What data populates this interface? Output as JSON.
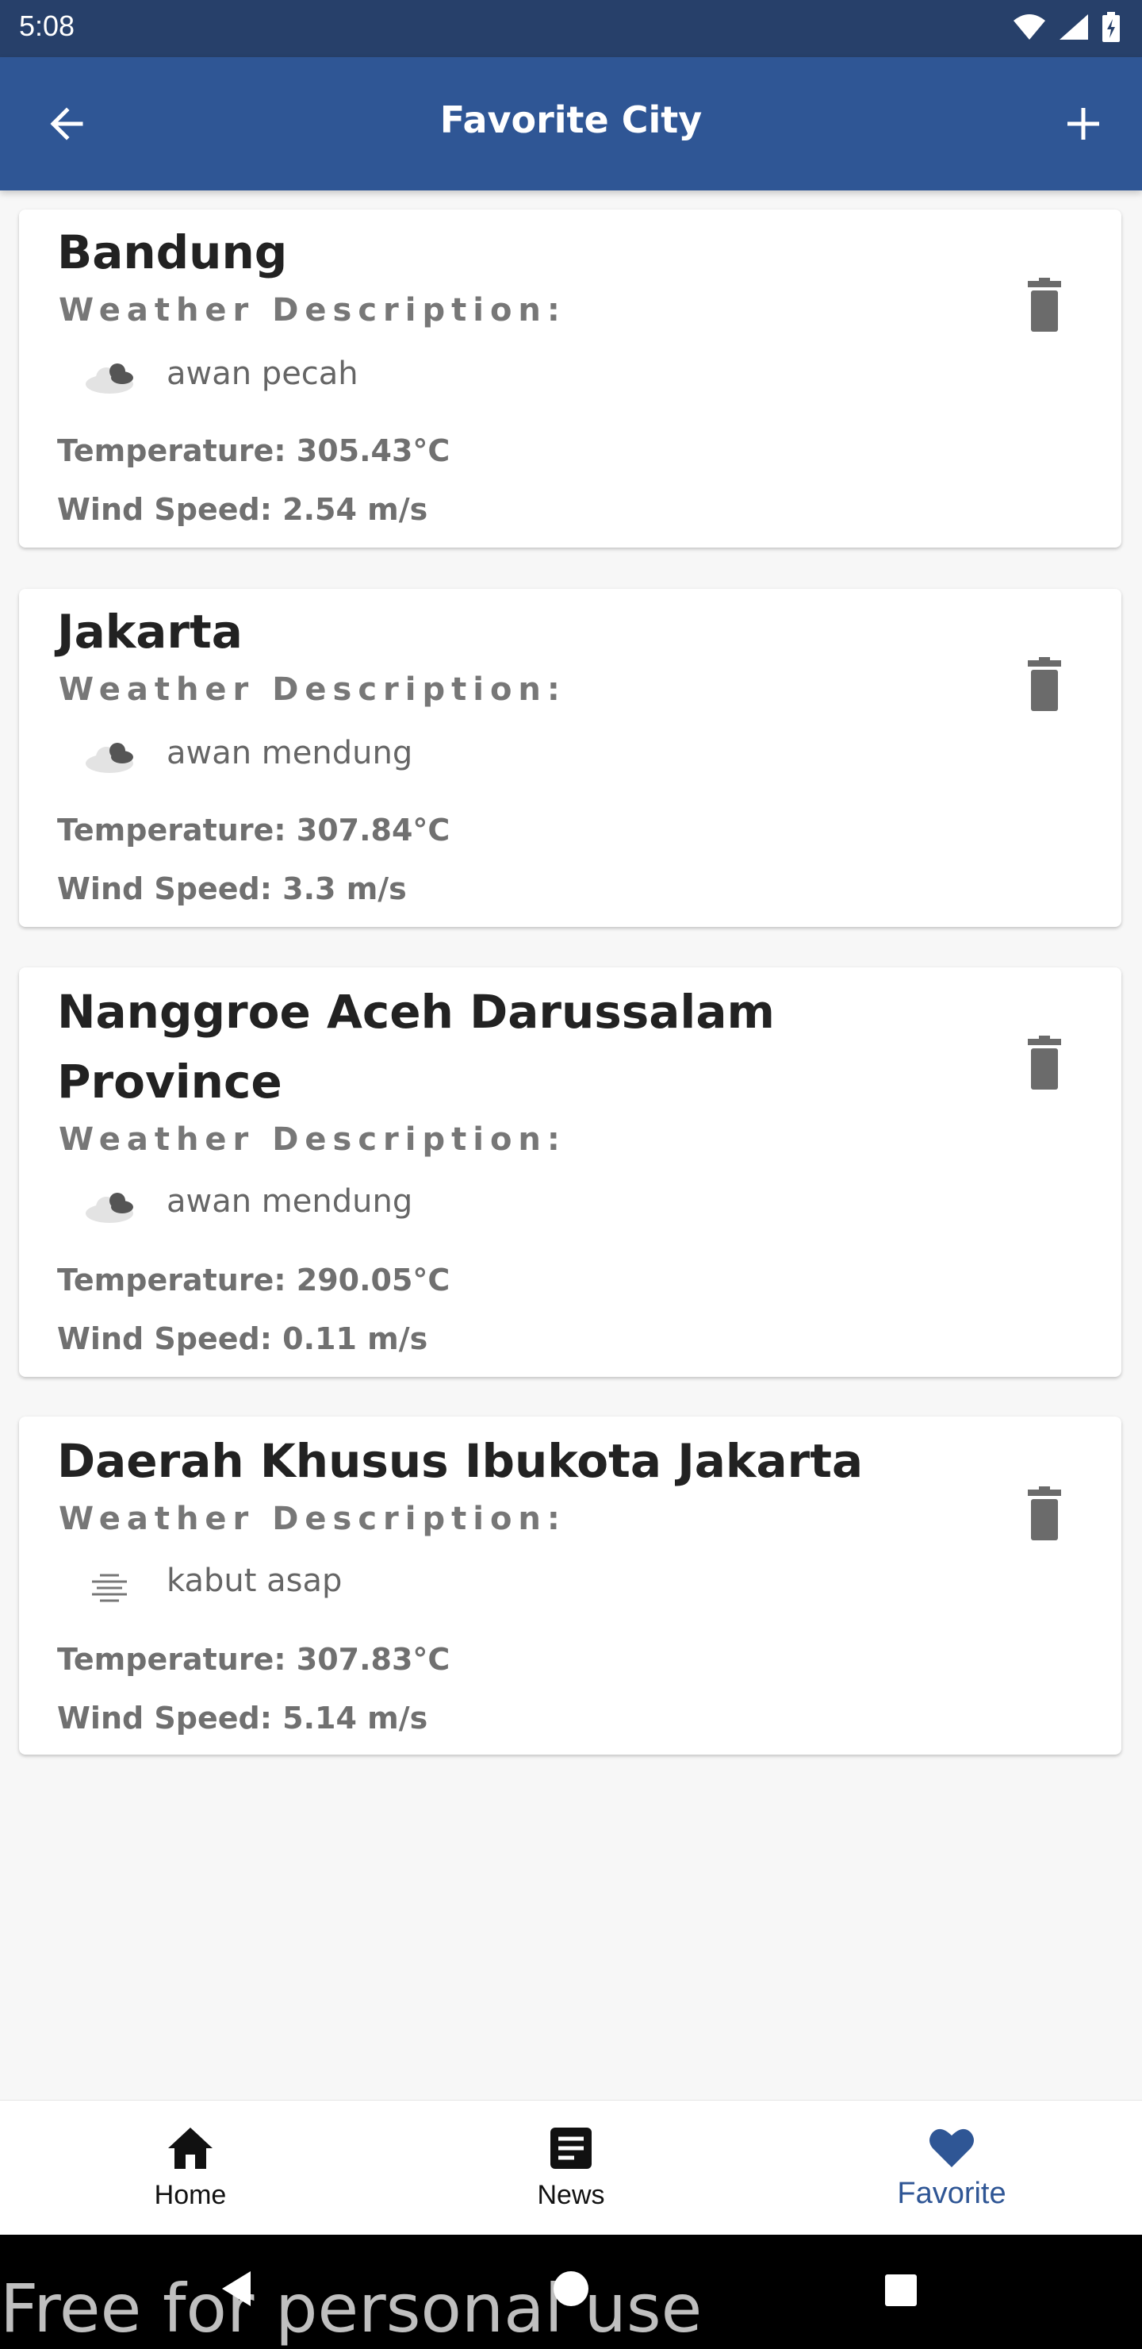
{
  "status_bar": {
    "time": "5:08"
  },
  "app_bar": {
    "title": "Favorite City"
  },
  "labels": {
    "weather_description": "Weather Description:"
  },
  "cities": [
    {
      "name": "Bandung",
      "description": "awan pecah",
      "icon": "broken-clouds-icon",
      "temperature": "Temperature: 305.43°C",
      "wind_speed": "Wind Speed: 2.54 m/s"
    },
    {
      "name": "Jakarta",
      "description": "awan mendung",
      "icon": "overcast-clouds-icon",
      "temperature": "Temperature: 307.84°C",
      "wind_speed": "Wind Speed: 3.3 m/s"
    },
    {
      "name": "Nanggroe Aceh Darussalam Province",
      "description": "awan mendung",
      "icon": "overcast-clouds-icon",
      "temperature": "Temperature: 290.05°C",
      "wind_speed": "Wind Speed: 0.11 m/s"
    },
    {
      "name": "Daerah Khusus Ibukota Jakarta",
      "description": "kabut asap",
      "icon": "haze-icon",
      "temperature": "Temperature: 307.83°C",
      "wind_speed": "Wind Speed: 5.14 m/s"
    }
  ],
  "bottom_nav": {
    "items": [
      {
        "label": "Home",
        "icon": "home-icon"
      },
      {
        "label": "News",
        "icon": "news-icon"
      },
      {
        "label": "Favorite",
        "icon": "heart-icon",
        "active": true
      }
    ],
    "active_color": "#2f5695"
  },
  "watermark": "Free for personal use",
  "colors": {
    "app_bar": "#2f5695",
    "status_bar": "#27406a"
  }
}
